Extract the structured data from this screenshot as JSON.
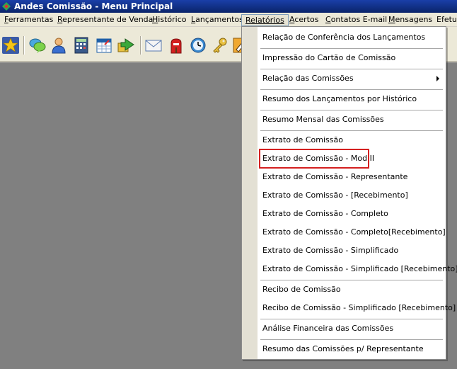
{
  "window": {
    "title": "Andes Comissão  - Menu Principal"
  },
  "menubar": {
    "items": [
      {
        "label": "Ferramentas",
        "mnemonic": "F",
        "rest": "erramentas"
      },
      {
        "label": "Representante de Venda",
        "mnemonic": "R",
        "rest": "epresentante de Venda"
      },
      {
        "label": "Histórico",
        "mnemonic": "H",
        "rest": "istórico"
      },
      {
        "label": "Lançamentos",
        "mnemonic": "L",
        "rest": "ançamentos"
      },
      {
        "label": "Relatórios",
        "mnemonic": "R",
        "rest": "elatórios"
      },
      {
        "label": "Acertos",
        "mnemonic": "A",
        "rest": "certos"
      },
      {
        "label": "Contatos E-mail",
        "mnemonic": "C",
        "rest": "ontatos E-mail"
      },
      {
        "label": "Mensagens",
        "mnemonic": "M",
        "rest": "ensagens"
      },
      {
        "label": "Efetua",
        "mnemonic": "",
        "rest": "Efetua"
      }
    ]
  },
  "toolbar": {
    "icons": [
      "star-icon",
      "chat-bubbles-icon",
      "user-icon",
      "calculator-icon",
      "calendar-icon",
      "transfer-icon",
      "envelope-icon",
      "mailbox-icon",
      "clock-icon",
      "key-icon",
      "pencil-icon"
    ]
  },
  "dropdown": {
    "items": [
      "Relação de Conferência dos Lançamentos",
      "Impressão do Cartão de Comissão",
      "Relação das Comissões",
      "Resumo dos Lançamentos por Histórico",
      "Resumo Mensal das Comissões",
      "Extrato de Comissão",
      "Extrato de Comissão - Mod II",
      "Extrato de Comissão - Representante",
      "Extrato de Comissão - [Recebimento]",
      "Extrato de Comissão - Completo",
      "Extrato de Comissão - Completo[Recebimento]",
      "Extrato de Comissão - Simplificado",
      "Extrato de Comissão - Simplificado [Recebimento]",
      "Recibo de Comissão",
      "Recibo de Comissão - Simplificado [Recebimento]",
      "Análise Financeira das Comissões",
      "Resumo das Comissões p/ Representante"
    ],
    "highlighted": "Extrato de Comissão - Mod II",
    "highlight_color": "#d42020"
  }
}
